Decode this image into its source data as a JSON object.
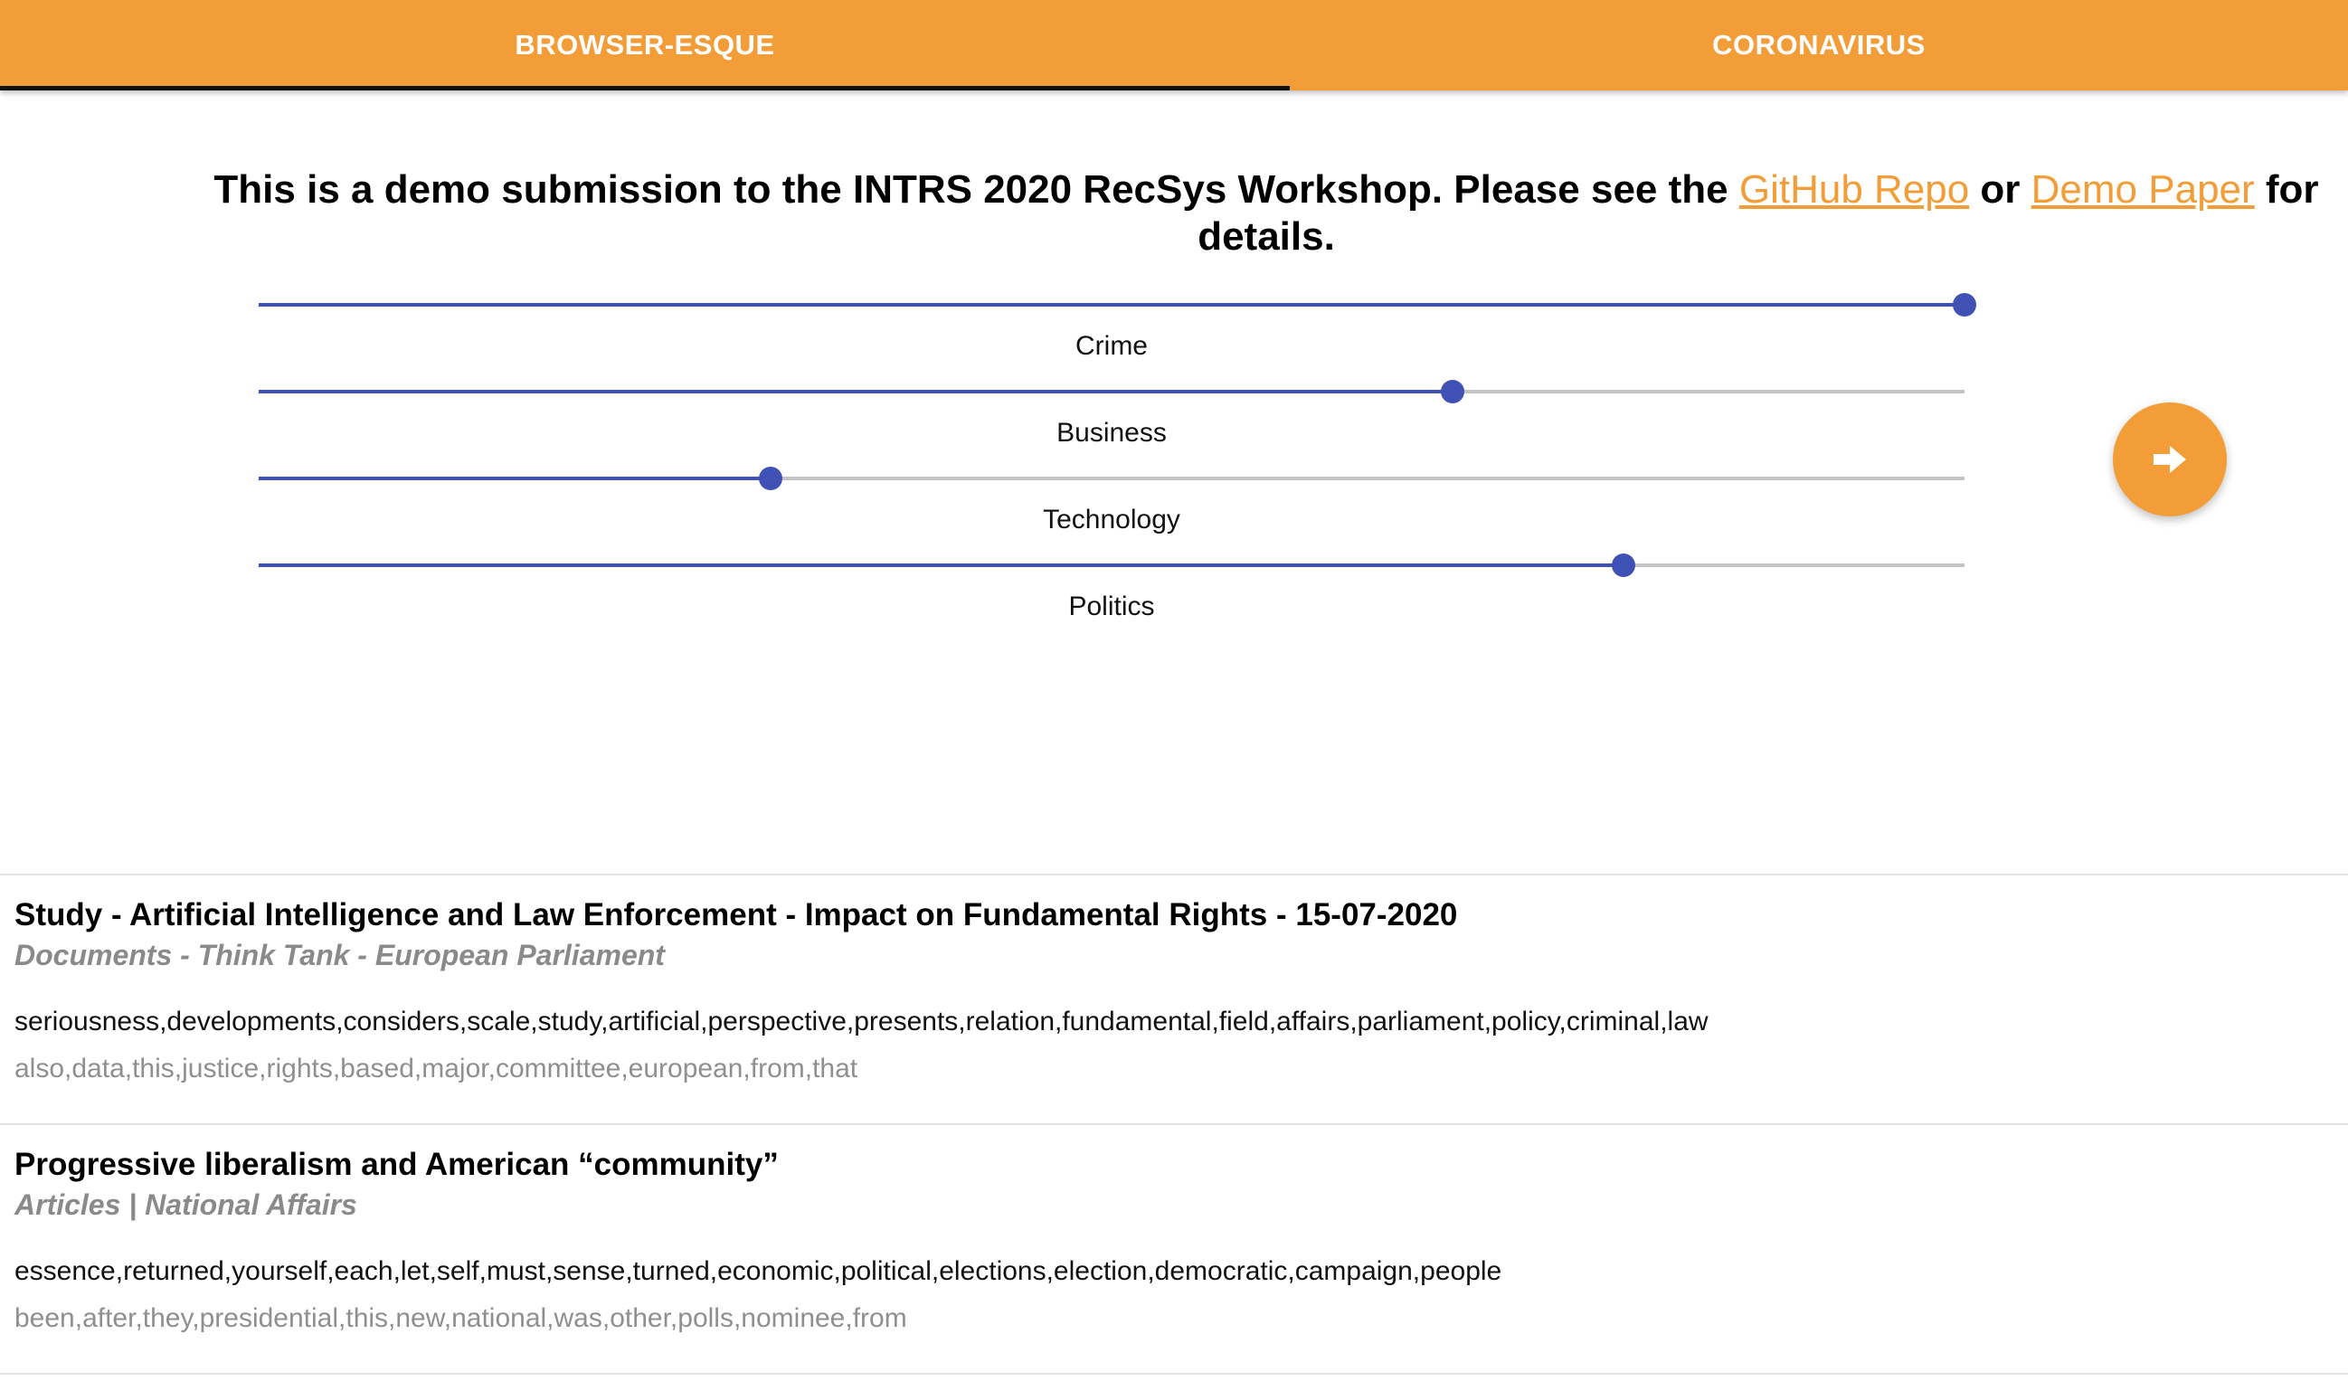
{
  "tabs": [
    {
      "label": "BROWSER-ESQUE",
      "active": true
    },
    {
      "label": "CORONAVIRUS",
      "active": false
    }
  ],
  "colors": {
    "accent": "#f29d38",
    "slider": "#3f51b5",
    "indicator": "#111111"
  },
  "intro": {
    "before": "This is a demo submission to the INTRS 2020 RecSys Workshop. Please see the ",
    "link1": "GitHub Repo",
    "middle": " or ",
    "link2": "Demo Paper",
    "after": " for details."
  },
  "sliders": [
    {
      "label": "Crime",
      "value": 1.0
    },
    {
      "label": "Business",
      "value": 0.7
    },
    {
      "label": "Technology",
      "value": 0.3
    },
    {
      "label": "Politics",
      "value": 0.8
    }
  ],
  "next_button": {
    "icon": "arrow-right-icon"
  },
  "articles": [
    {
      "title": "Study - Artificial Intelligence and Law Enforcement - Impact on Fundamental Rights - 15-07-2020",
      "source": "Documents - Think Tank - European Parliament",
      "keywords_primary": "seriousness,developments,considers,scale,study,artificial,perspective,presents,relation,fundamental,field,affairs,parliament,policy,criminal,law",
      "keywords_secondary": "also,data,this,justice,rights,based,major,committee,european,from,that"
    },
    {
      "title": "Progressive liberalism and American “community”",
      "source": "Articles | National Affairs",
      "keywords_primary": "essence,returned,yourself,each,let,self,must,sense,turned,economic,political,elections,election,democratic,campaign,people",
      "keywords_secondary": "been,after,they,presidential,this,new,national,was,other,polls,nominee,from"
    }
  ]
}
